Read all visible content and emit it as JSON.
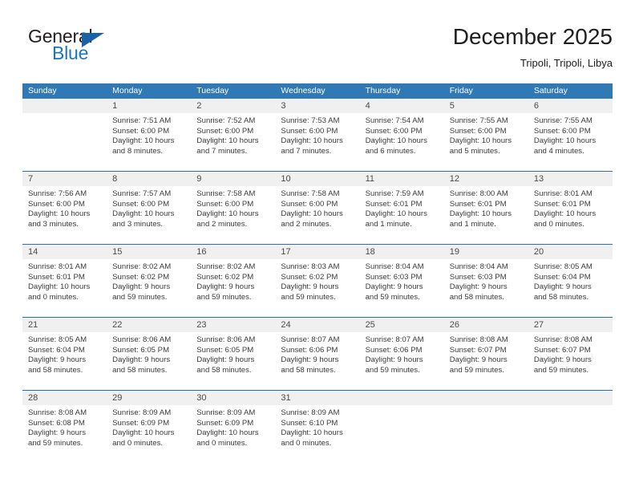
{
  "brand": {
    "word_one": "General",
    "word_two": "Blue",
    "triangle_icon": "brand-triangle-icon",
    "colors": {
      "general_text": "#231f20",
      "blue_text": "#1b75bb",
      "triangle": "#1b61a8"
    }
  },
  "header": {
    "title": "December 2025",
    "subtitle": "Tripoli, Tripoli, Libya"
  },
  "theme": {
    "header_row_bg": "#3079b5",
    "day_band_bg": "#f0f0f0",
    "week_separator": "#2c6ea5",
    "text": "#3c3c3c"
  },
  "calendar": {
    "weekday_headers": [
      "Sunday",
      "Monday",
      "Tuesday",
      "Wednesday",
      "Thursday",
      "Friday",
      "Saturday"
    ],
    "weeks": [
      [
        {
          "day": "",
          "sunrise": "",
          "sunset": "",
          "daylight_1": "",
          "daylight_2": ""
        },
        {
          "day": "1",
          "sunrise": "Sunrise: 7:51 AM",
          "sunset": "Sunset: 6:00 PM",
          "daylight_1": "Daylight: 10 hours",
          "daylight_2": "and 8 minutes."
        },
        {
          "day": "2",
          "sunrise": "Sunrise: 7:52 AM",
          "sunset": "Sunset: 6:00 PM",
          "daylight_1": "Daylight: 10 hours",
          "daylight_2": "and 7 minutes."
        },
        {
          "day": "3",
          "sunrise": "Sunrise: 7:53 AM",
          "sunset": "Sunset: 6:00 PM",
          "daylight_1": "Daylight: 10 hours",
          "daylight_2": "and 7 minutes."
        },
        {
          "day": "4",
          "sunrise": "Sunrise: 7:54 AM",
          "sunset": "Sunset: 6:00 PM",
          "daylight_1": "Daylight: 10 hours",
          "daylight_2": "and 6 minutes."
        },
        {
          "day": "5",
          "sunrise": "Sunrise: 7:55 AM",
          "sunset": "Sunset: 6:00 PM",
          "daylight_1": "Daylight: 10 hours",
          "daylight_2": "and 5 minutes."
        },
        {
          "day": "6",
          "sunrise": "Sunrise: 7:55 AM",
          "sunset": "Sunset: 6:00 PM",
          "daylight_1": "Daylight: 10 hours",
          "daylight_2": "and 4 minutes."
        }
      ],
      [
        {
          "day": "7",
          "sunrise": "Sunrise: 7:56 AM",
          "sunset": "Sunset: 6:00 PM",
          "daylight_1": "Daylight: 10 hours",
          "daylight_2": "and 3 minutes."
        },
        {
          "day": "8",
          "sunrise": "Sunrise: 7:57 AM",
          "sunset": "Sunset: 6:00 PM",
          "daylight_1": "Daylight: 10 hours",
          "daylight_2": "and 3 minutes."
        },
        {
          "day": "9",
          "sunrise": "Sunrise: 7:58 AM",
          "sunset": "Sunset: 6:00 PM",
          "daylight_1": "Daylight: 10 hours",
          "daylight_2": "and 2 minutes."
        },
        {
          "day": "10",
          "sunrise": "Sunrise: 7:58 AM",
          "sunset": "Sunset: 6:00 PM",
          "daylight_1": "Daylight: 10 hours",
          "daylight_2": "and 2 minutes."
        },
        {
          "day": "11",
          "sunrise": "Sunrise: 7:59 AM",
          "sunset": "Sunset: 6:01 PM",
          "daylight_1": "Daylight: 10 hours",
          "daylight_2": "and 1 minute."
        },
        {
          "day": "12",
          "sunrise": "Sunrise: 8:00 AM",
          "sunset": "Sunset: 6:01 PM",
          "daylight_1": "Daylight: 10 hours",
          "daylight_2": "and 1 minute."
        },
        {
          "day": "13",
          "sunrise": "Sunrise: 8:01 AM",
          "sunset": "Sunset: 6:01 PM",
          "daylight_1": "Daylight: 10 hours",
          "daylight_2": "and 0 minutes."
        }
      ],
      [
        {
          "day": "14",
          "sunrise": "Sunrise: 8:01 AM",
          "sunset": "Sunset: 6:01 PM",
          "daylight_1": "Daylight: 10 hours",
          "daylight_2": "and 0 minutes."
        },
        {
          "day": "15",
          "sunrise": "Sunrise: 8:02 AM",
          "sunset": "Sunset: 6:02 PM",
          "daylight_1": "Daylight: 9 hours",
          "daylight_2": "and 59 minutes."
        },
        {
          "day": "16",
          "sunrise": "Sunrise: 8:02 AM",
          "sunset": "Sunset: 6:02 PM",
          "daylight_1": "Daylight: 9 hours",
          "daylight_2": "and 59 minutes."
        },
        {
          "day": "17",
          "sunrise": "Sunrise: 8:03 AM",
          "sunset": "Sunset: 6:02 PM",
          "daylight_1": "Daylight: 9 hours",
          "daylight_2": "and 59 minutes."
        },
        {
          "day": "18",
          "sunrise": "Sunrise: 8:04 AM",
          "sunset": "Sunset: 6:03 PM",
          "daylight_1": "Daylight: 9 hours",
          "daylight_2": "and 59 minutes."
        },
        {
          "day": "19",
          "sunrise": "Sunrise: 8:04 AM",
          "sunset": "Sunset: 6:03 PM",
          "daylight_1": "Daylight: 9 hours",
          "daylight_2": "and 58 minutes."
        },
        {
          "day": "20",
          "sunrise": "Sunrise: 8:05 AM",
          "sunset": "Sunset: 6:04 PM",
          "daylight_1": "Daylight: 9 hours",
          "daylight_2": "and 58 minutes."
        }
      ],
      [
        {
          "day": "21",
          "sunrise": "Sunrise: 8:05 AM",
          "sunset": "Sunset: 6:04 PM",
          "daylight_1": "Daylight: 9 hours",
          "daylight_2": "and 58 minutes."
        },
        {
          "day": "22",
          "sunrise": "Sunrise: 8:06 AM",
          "sunset": "Sunset: 6:05 PM",
          "daylight_1": "Daylight: 9 hours",
          "daylight_2": "and 58 minutes."
        },
        {
          "day": "23",
          "sunrise": "Sunrise: 8:06 AM",
          "sunset": "Sunset: 6:05 PM",
          "daylight_1": "Daylight: 9 hours",
          "daylight_2": "and 58 minutes."
        },
        {
          "day": "24",
          "sunrise": "Sunrise: 8:07 AM",
          "sunset": "Sunset: 6:06 PM",
          "daylight_1": "Daylight: 9 hours",
          "daylight_2": "and 58 minutes."
        },
        {
          "day": "25",
          "sunrise": "Sunrise: 8:07 AM",
          "sunset": "Sunset: 6:06 PM",
          "daylight_1": "Daylight: 9 hours",
          "daylight_2": "and 59 minutes."
        },
        {
          "day": "26",
          "sunrise": "Sunrise: 8:08 AM",
          "sunset": "Sunset: 6:07 PM",
          "daylight_1": "Daylight: 9 hours",
          "daylight_2": "and 59 minutes."
        },
        {
          "day": "27",
          "sunrise": "Sunrise: 8:08 AM",
          "sunset": "Sunset: 6:07 PM",
          "daylight_1": "Daylight: 9 hours",
          "daylight_2": "and 59 minutes."
        }
      ],
      [
        {
          "day": "28",
          "sunrise": "Sunrise: 8:08 AM",
          "sunset": "Sunset: 6:08 PM",
          "daylight_1": "Daylight: 9 hours",
          "daylight_2": "and 59 minutes."
        },
        {
          "day": "29",
          "sunrise": "Sunrise: 8:09 AM",
          "sunset": "Sunset: 6:09 PM",
          "daylight_1": "Daylight: 10 hours",
          "daylight_2": "and 0 minutes."
        },
        {
          "day": "30",
          "sunrise": "Sunrise: 8:09 AM",
          "sunset": "Sunset: 6:09 PM",
          "daylight_1": "Daylight: 10 hours",
          "daylight_2": "and 0 minutes."
        },
        {
          "day": "31",
          "sunrise": "Sunrise: 8:09 AM",
          "sunset": "Sunset: 6:10 PM",
          "daylight_1": "Daylight: 10 hours",
          "daylight_2": "and 0 minutes."
        },
        {
          "day": "",
          "sunrise": "",
          "sunset": "",
          "daylight_1": "",
          "daylight_2": ""
        },
        {
          "day": "",
          "sunrise": "",
          "sunset": "",
          "daylight_1": "",
          "daylight_2": ""
        },
        {
          "day": "",
          "sunrise": "",
          "sunset": "",
          "daylight_1": "",
          "daylight_2": ""
        }
      ]
    ]
  }
}
